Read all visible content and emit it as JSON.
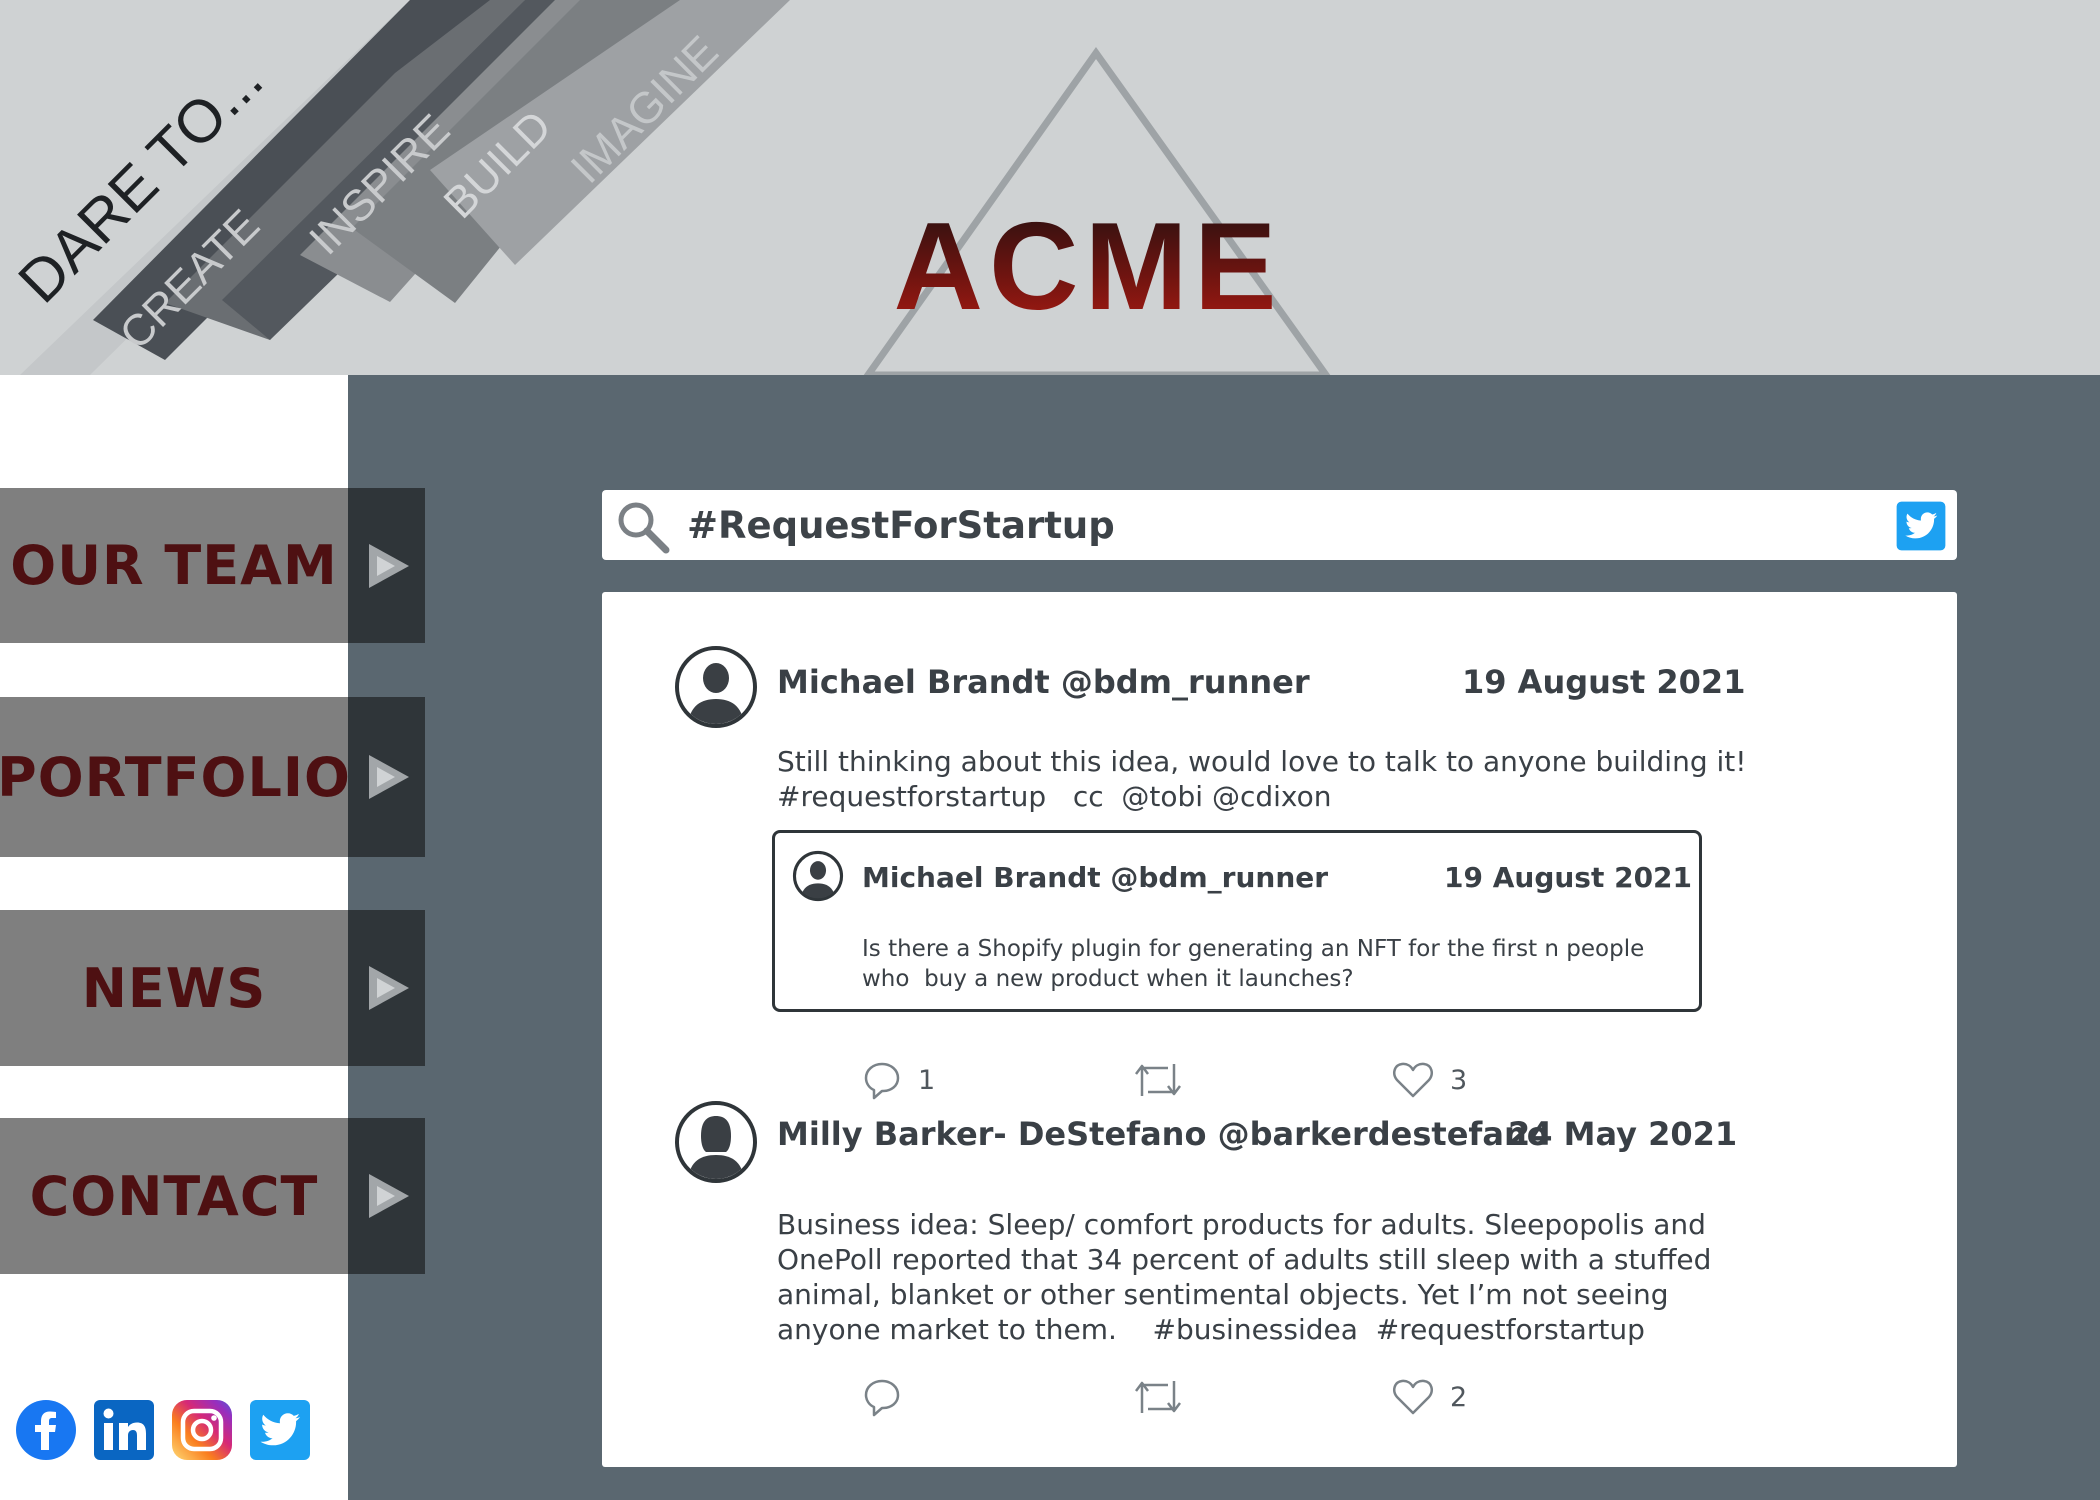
{
  "header": {
    "tagline": "DARE TO...",
    "banner_words": [
      "CREATE",
      "INSPIRE",
      "BUILD",
      "IMAGINE"
    ],
    "logo": "ACME"
  },
  "nav": {
    "items": [
      "OUR TEAM",
      "PORTFOLIO",
      "NEWS",
      "CONTACT"
    ]
  },
  "socials": [
    "facebook-icon",
    "linkedin-icon",
    "instagram-icon",
    "twitter-icon"
  ],
  "search": {
    "query": "#RequestForStartup"
  },
  "tweets": [
    {
      "author": "Michael Brandt @bdm_runner",
      "date": "19 August 2021",
      "text_lines": [
        "Still thinking about this idea, would love to talk to anyone building it!",
        "#requestforstartup   cc  @tobi @cdixon"
      ],
      "quoted": {
        "author": "Michael Brandt @bdm_runner",
        "date": "19 August 2021",
        "text_lines": [
          "Is there a Shopify plugin for generating an NFT for the first n people",
          "who  buy a new product when it launches?"
        ]
      },
      "replies": "1",
      "retweets": "",
      "likes": "3"
    },
    {
      "author": "Milly  Barker- DeStefano  @barkerdestefano",
      "date": "24 May 2021",
      "text_lines": [
        "Business idea: Sleep/ comfort products for adults. Sleepopolis and",
        "OnePoll reported that 34 percent of adults still sleep with a stuffed",
        "animal, blanket or other sentimental objects. Yet I’m not seeing",
        "anyone market to them.    #businessidea  #requestforstartup"
      ],
      "replies": "",
      "retweets": "",
      "likes": "2"
    }
  ],
  "colors": {
    "header_bg": "#cfd2d3",
    "main_bg": "#5a6770",
    "nav_bg": "#7f7f7f",
    "nav_arrow_bg": "#2f3539",
    "nav_text": "#4e1012",
    "logo_red": "#a51a12",
    "twitter_blue": "#1da1f2"
  }
}
